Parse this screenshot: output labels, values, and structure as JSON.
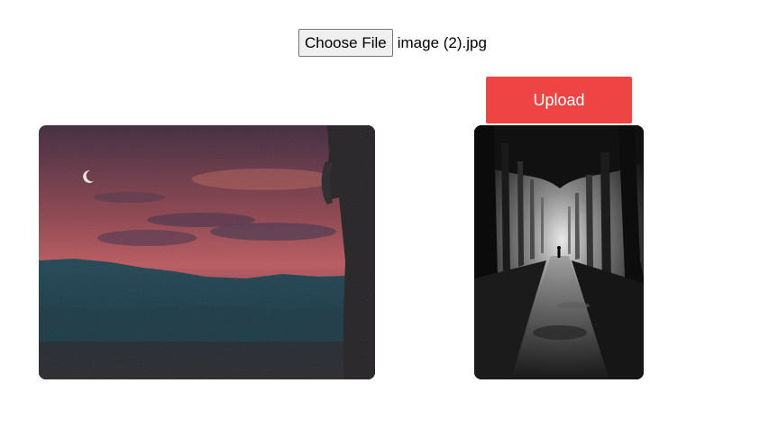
{
  "file_input": {
    "button_label": "Choose File",
    "file_name": "image (2).jpg"
  },
  "upload": {
    "label": "Upload",
    "color": "#ef4444"
  },
  "images": [
    {
      "subject": "dusk sky with crescent moon, mountains and silhouette"
    },
    {
      "subject": "black-and-white forest path with walking figure"
    }
  ]
}
